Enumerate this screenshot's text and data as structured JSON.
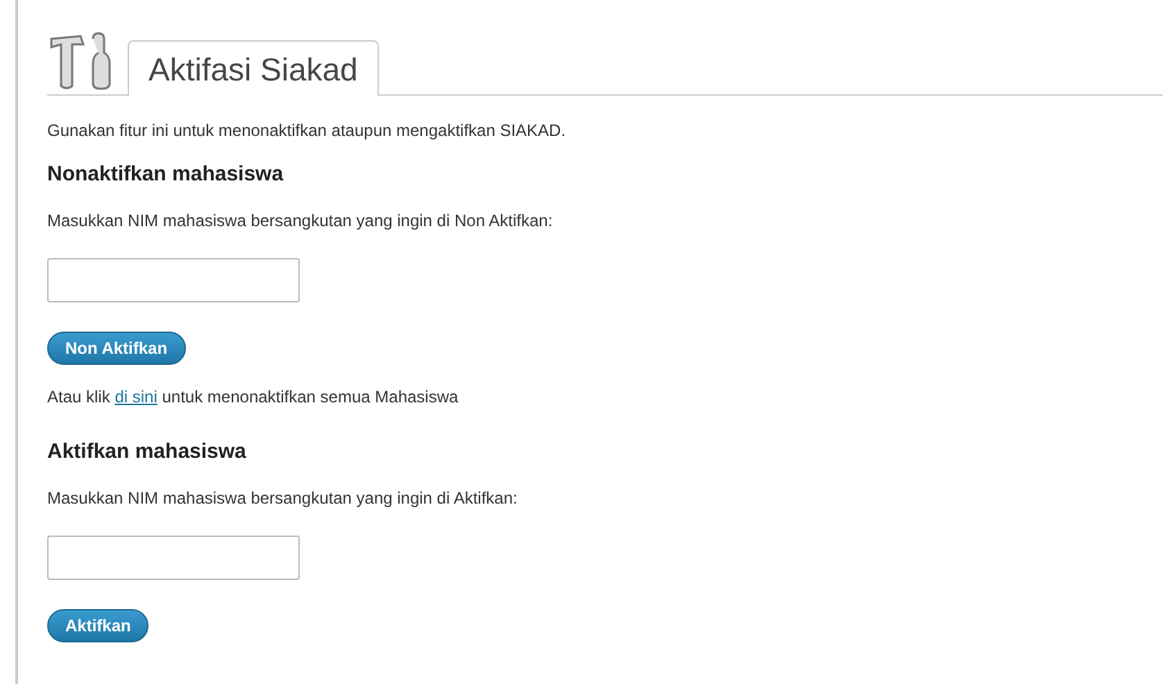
{
  "tab": {
    "title": "Aktifasi Siakad",
    "selected": true
  },
  "intro": "Gunakan fitur ini untuk menonaktifkan ataupun mengaktifkan SIAKAD.",
  "sections": [
    {
      "heading": "Nonaktifkan mahasiswa",
      "label": "Masukkan NIM mahasiswa bersangkutan yang ingin di Non Aktifkan:",
      "button": "Non Aktifkan",
      "note": {
        "before": "Atau klik",
        "link": "di sini",
        "after": "untuk menonaktifkan semua Mahasiswa"
      }
    },
    {
      "heading": "Aktifkan mahasiswa",
      "label": "Masukkan NIM mahasiswa bersangkutan yang ingin di Aktifkan:",
      "button": "Aktifkan"
    }
  ]
}
